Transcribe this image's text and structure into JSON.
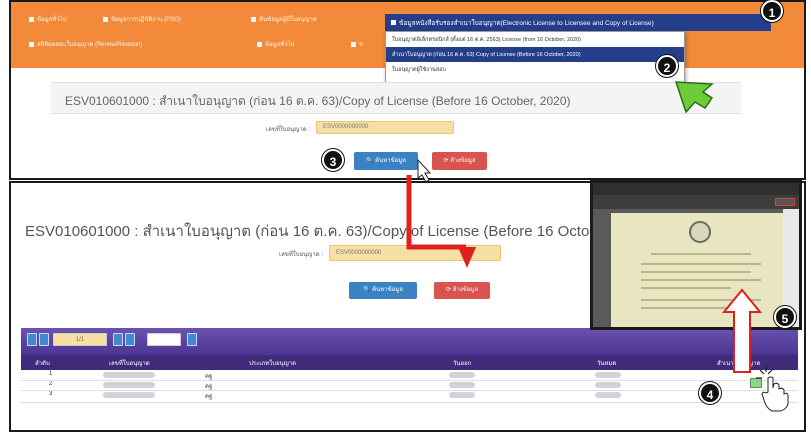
{
  "nav": {
    "row1": [
      "ข้อมูลทั่วไป",
      "ข้อมูลการปฏิบัติงาน (PSO)",
      "ค้นข้อมูลผู้มีใบอนุญาต"
    ],
    "row2": [
      "สถิติผลสอบใบอนุญาต (Renew/Revision)",
      "ข้อมูลทั่วไป",
      "ข"
    ],
    "dropdown_label": "ข้อมูลหนังสือรับรองสำเนาใบอนุญาต(Electronic License to Licensee and Copy of License)",
    "dropdown_items": [
      "ใบอนุญาตอิเล็กทรอนิกส์ (ตั้งแต่ 16 ต.ค. 2563) License (from 16 October, 2020)",
      "สำเนาใบอนุญาต (ก่อน 16 ต.ค. 63) Copy of License (Before 16 October, 2020)",
      "ใบอนุญาตผู้ใช้งานสอบ"
    ]
  },
  "page_title": "ESV010601000 : สำเนาใบอนุญาต (ก่อน 16 ต.ค. 63)/Copy of License (Before 16 October, 2020)",
  "filter": {
    "label": "เลขที่ใบอนุญาต :",
    "value": "ESV0000000000"
  },
  "buttons": {
    "search": "ค้นหาข้อมูล",
    "clear": "ล้างข้อมูล"
  },
  "pager": {
    "page": "1/1"
  },
  "table": {
    "headers": [
      "ลำดับ",
      "เลขที่ใบอนุญาต",
      "ประเภทใบอนุญาต",
      "วันออก",
      "วันหมด",
      "สำเนาใบอนุญาต"
    ],
    "rows": [
      {
        "no": "1",
        "type": "คฐ"
      },
      {
        "no": "2",
        "type": "คฐ"
      },
      {
        "no": "3",
        "type": "คฐ"
      }
    ]
  },
  "steps": [
    "1",
    "2",
    "3",
    "4",
    "5"
  ],
  "colors": {
    "nav_orange": "#f28a3a",
    "nav_blue": "#243e8c",
    "pager_purple": "#5a3ea0",
    "header_purple": "#3f2b7a",
    "annotation_red": "#e02020",
    "cursor_green": "#6dcc3c"
  }
}
